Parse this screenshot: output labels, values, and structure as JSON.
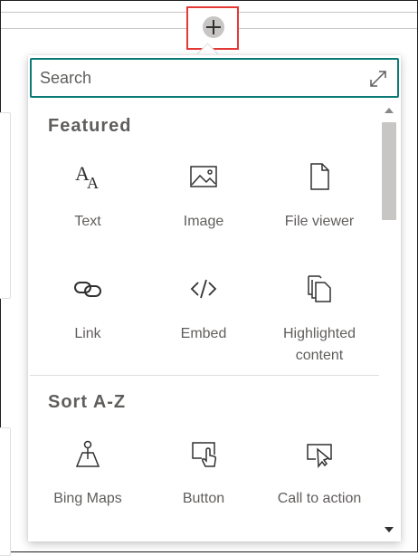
{
  "search": {
    "placeholder": "Search"
  },
  "sections": {
    "featured": {
      "title": "Featured",
      "tiles": [
        {
          "label": "Text",
          "icon": "text-font-icon"
        },
        {
          "label": "Image",
          "icon": "image-icon"
        },
        {
          "label": "File viewer",
          "icon": "document-icon"
        },
        {
          "label": "Link",
          "icon": "link-icon"
        },
        {
          "label": "Embed",
          "icon": "code-icon"
        },
        {
          "label": "Highlighted content",
          "icon": "copy-pages-icon"
        }
      ]
    },
    "sort_az": {
      "title": "Sort A-Z",
      "tiles": [
        {
          "label": "Bing Maps",
          "icon": "map-pin-icon"
        },
        {
          "label": "Button",
          "icon": "pointer-hand-icon"
        },
        {
          "label": "Call to action",
          "icon": "cursor-box-icon"
        }
      ]
    }
  },
  "colors": {
    "accent": "#0b7a75",
    "highlight": "#e53935"
  }
}
